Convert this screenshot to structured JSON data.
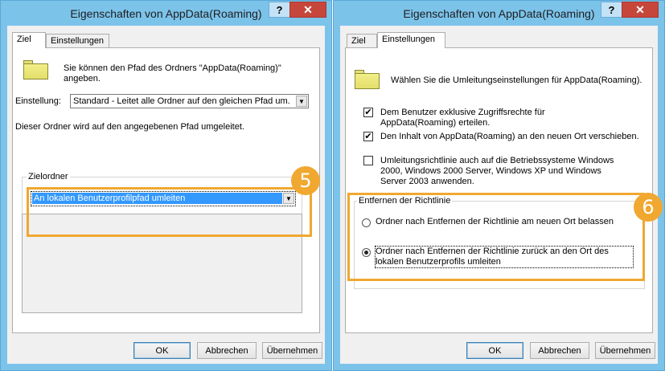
{
  "left": {
    "title": "Eigenschaften von AppData(Roaming)",
    "help": "?",
    "close": "✕",
    "tabs": [
      "Ziel",
      "Einstellungen"
    ],
    "description": "Sie können den Pfad des Ordners \"AppData(Roaming)\" angeben.",
    "setting_label": "Einstellung:",
    "setting_value": "Standard - Leitet alle Ordner auf den gleichen Pfad um.",
    "info": "Dieser Ordner wird auf den angegebenen Pfad umgeleitet.",
    "group_title": "Zielordner",
    "target_value": "An lokalen Benutzerprofilpfad umleiten",
    "badge": "5",
    "buttons": {
      "ok": "OK",
      "cancel": "Abbrechen",
      "apply": "Übernehmen"
    }
  },
  "right": {
    "title": "Eigenschaften von AppData(Roaming)",
    "help": "?",
    "close": "✕",
    "tabs": [
      "Ziel",
      "Einstellungen"
    ],
    "description": "Wählen Sie die Umleitungseinstellungen für AppData(Roaming).",
    "checks": [
      {
        "label": "Dem Benutzer exklusive Zugriffsrechte für AppData(Roaming) erteilen.",
        "checked": true
      },
      {
        "label": "Den Inhalt von AppData(Roaming) an den neuen Ort verschieben.",
        "checked": true
      },
      {
        "label": "Umleitungsrichtlinie auch auf die Betriebssysteme Windows 2000, Windows 2000 Server, Windows XP und Windows Server 2003 anwenden.",
        "checked": false
      }
    ],
    "group_title": "Entfernen der Richtlinie",
    "radios": [
      {
        "label": "Ordner nach Entfernen der Richtlinie am neuen Ort belassen",
        "selected": false
      },
      {
        "label": "Ordner nach Entfernen der Richtlinie zurück an den Ort des lokalen Benutzerprofils umleiten",
        "selected": true
      }
    ],
    "badge": "6",
    "buttons": {
      "ok": "OK",
      "cancel": "Abbrechen",
      "apply": "Übernehmen"
    }
  },
  "colors": {
    "accent": "#f0a830",
    "titlebar": "#7cc3ea",
    "close": "#c7463b",
    "selection": "#3399ff"
  }
}
